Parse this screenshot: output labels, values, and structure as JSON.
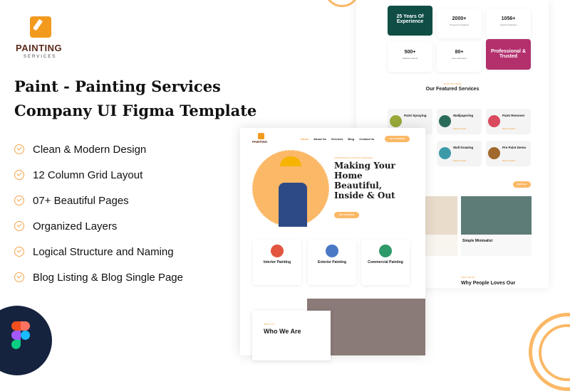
{
  "logo": {
    "name": "PAINTING",
    "sub": "SERVICES"
  },
  "title": {
    "line1": "Paint - Painting Services",
    "line2": "Company UI Figma Template"
  },
  "features": [
    "Clean & Modern Design",
    "12 Column Grid Layout",
    "07+ Beautiful Pages",
    "Organized Layers",
    "Logical Structure and Naming",
    "Blog Listing & Blog Single Page"
  ],
  "back": {
    "stats": [
      {
        "value": "25 Years Of Experience",
        "label": ""
      },
      {
        "value": "2000+",
        "label": "Projects Completed"
      },
      {
        "value": "1056+",
        "label": "Industry Solutions"
      },
      {
        "value": "500+",
        "label": "Satisfied Clients"
      },
      {
        "value": "80+",
        "label": "Team Members"
      },
      {
        "value": "Professional & Trusted",
        "label": ""
      }
    ],
    "services_eyebrow": "WHAT WE OFFER",
    "services_title": "Our Featured Services",
    "services": [
      {
        "name": "Paint Spraying",
        "color": "#9aa93a"
      },
      {
        "name": "Wallpapering",
        "color": "#2b6b5a"
      },
      {
        "name": "Paint Remover",
        "color": "#d94a5e"
      },
      {
        "name": "Wall Drawing",
        "color": "#3c9aa8"
      },
      {
        "name": "Pre Paint Demo",
        "color": "#a0682c"
      }
    ],
    "read_more": "READ MORE →",
    "view_all": "VIEW ALL",
    "blog_title": "Simple Minimalist",
    "why_eyebrow": "WHAT WE DO",
    "why_title": "Why People Loves Our"
  },
  "front": {
    "nav": [
      "Home",
      "About Us",
      "Services",
      "Blog",
      "Contact Us"
    ],
    "cta": "GET STARTED",
    "eyebrow": "PROFESSIONAL PAINTING SERVICES",
    "hero_title": "Making Your Home Beautiful, Inside & Out",
    "hero_cta": "GET STARTED",
    "cards": [
      {
        "name": "Interior Painting",
        "color": "#e2553f"
      },
      {
        "name": "Exterior Painting",
        "color": "#4a78c4"
      },
      {
        "name": "Commercial Painting",
        "color": "#2f9a6a"
      }
    ],
    "about_eyebrow": "ABOUT US",
    "about_title": "Who We Are"
  },
  "colors": {
    "accent": "#fbb866",
    "green": "#0f4d45",
    "magenta": "#b3306d",
    "navy": "#16233f"
  }
}
